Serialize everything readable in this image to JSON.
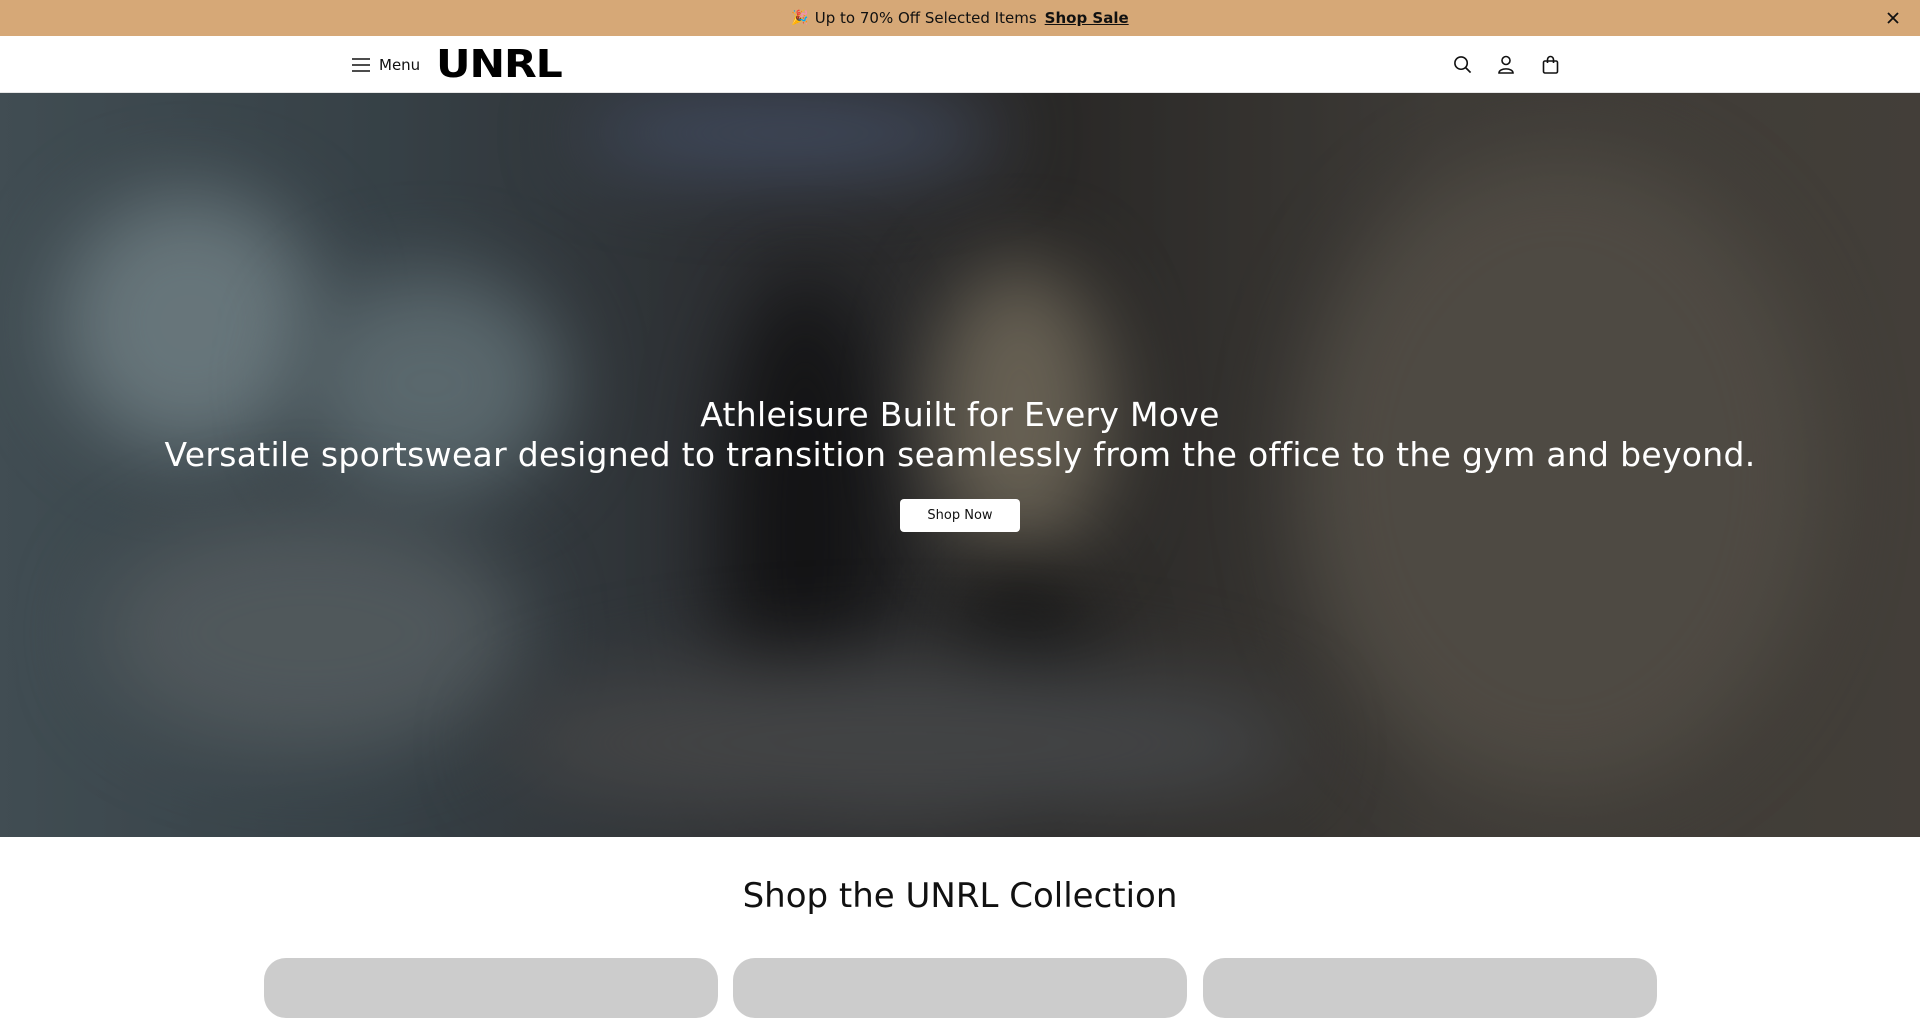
{
  "announcement": {
    "emoji": "🎉",
    "text": "Up to 70% Off Selected Items",
    "link": "Shop Sale",
    "close_label": "✕"
  },
  "header": {
    "menu_label": "Menu",
    "logo_text": "UNRL",
    "icons": [
      "search-icon",
      "account-icon",
      "bag-icon"
    ]
  },
  "hero": {
    "title": "Athleisure Built for Every Move",
    "subtitle": "Versatile sportswear designed to transition seamlessly from the office to the gym and beyond.",
    "button_label": "Shop Now"
  },
  "collection": {
    "title": "Shop the UNRL Collection",
    "card_count": 3
  },
  "colors": {
    "announcement_bg": "#d6a877",
    "card_placeholder": "#cccccc"
  }
}
